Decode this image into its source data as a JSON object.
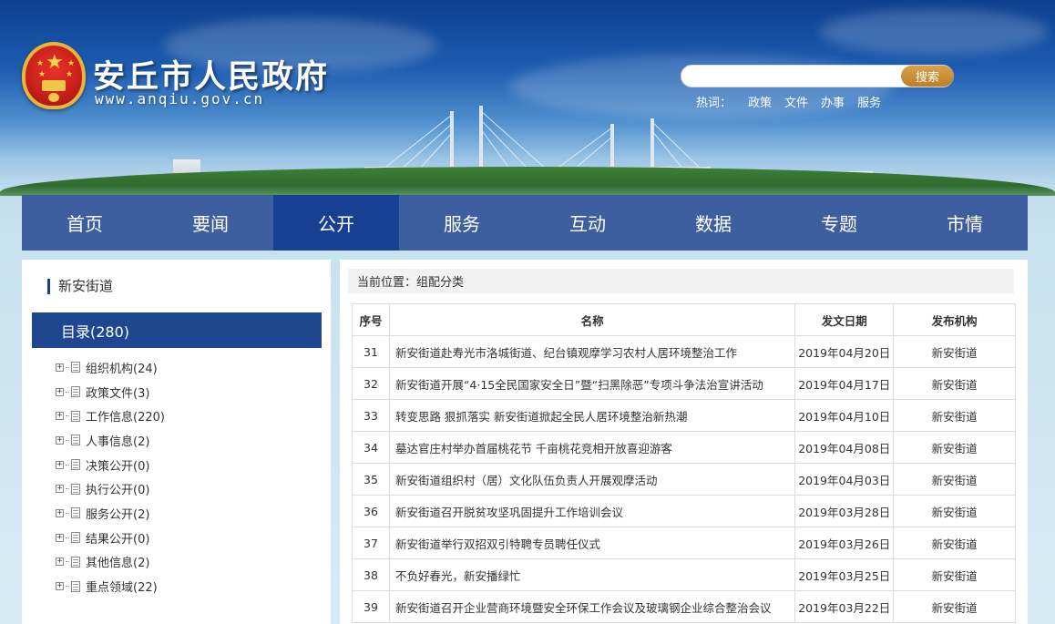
{
  "header": {
    "title": "安丘市人民政府",
    "url": "www.anqiu.gov.cn",
    "search": {
      "placeholder": "",
      "button": "搜索"
    },
    "hotwords_label": "热词：",
    "hotwords": [
      "政策",
      "文件",
      "办事",
      "服务"
    ]
  },
  "nav": {
    "items": [
      "首页",
      "要闻",
      "公开",
      "服务",
      "互动",
      "数据",
      "专题",
      "市情"
    ],
    "active": "公开"
  },
  "sidebar": {
    "dept": "新安街道",
    "catalog": "目录(280)",
    "items": [
      "组织机构(24)",
      "政策文件(3)",
      "工作信息(220)",
      "人事信息(2)",
      "决策公开(0)",
      "执行公开(0)",
      "服务公开(2)",
      "结果公开(0)",
      "其他信息(2)",
      "重点领域(22)"
    ]
  },
  "main": {
    "breadcrumb": "当前位置：组配分类",
    "columns": [
      "序号",
      "名称",
      "发文日期",
      "发布机构"
    ],
    "rows": [
      {
        "num": "31",
        "name": "新安街道赴寿光市洛城街道、纪台镇观摩学习农村人居环境整治工作",
        "date": "2019年04月20日",
        "org": "新安街道"
      },
      {
        "num": "32",
        "name": "新安街道开展“4·15全民国家安全日”暨“扫黑除恶”专项斗争法治宣讲活动",
        "date": "2019年04月17日",
        "org": "新安街道"
      },
      {
        "num": "33",
        "name": "转变思路 狠抓落实 新安街道掀起全民人居环境整治新热潮",
        "date": "2019年04月10日",
        "org": "新安街道"
      },
      {
        "num": "34",
        "name": "墓达官庄村举办首届桃花节 千亩桃花竞相开放喜迎游客",
        "date": "2019年04月08日",
        "org": "新安街道"
      },
      {
        "num": "35",
        "name": "新安街道组织村（居）文化队伍负责人开展观摩活动",
        "date": "2019年04月03日",
        "org": "新安街道"
      },
      {
        "num": "36",
        "name": "新安街道召开脱贫攻坚巩固提升工作培训会议",
        "date": "2019年03月28日",
        "org": "新安街道"
      },
      {
        "num": "37",
        "name": "新安街道举行双招双引特聘专员聘任仪式",
        "date": "2019年03月26日",
        "org": "新安街道"
      },
      {
        "num": "38",
        "name": "不负好春光，新安播绿忙",
        "date": "2019年03月25日",
        "org": "新安街道"
      },
      {
        "num": "39",
        "name": "新安街道召开企业营商环境暨安全环保工作会议及玻璃钢企业综合整治会议",
        "date": "2019年03月22日",
        "org": "新安街道"
      }
    ]
  },
  "colors": {
    "nav_bg": "#3d5f9f",
    "nav_active": "#173f92",
    "catalog_bg": "#1e4790",
    "search_button": "#c98a30"
  }
}
